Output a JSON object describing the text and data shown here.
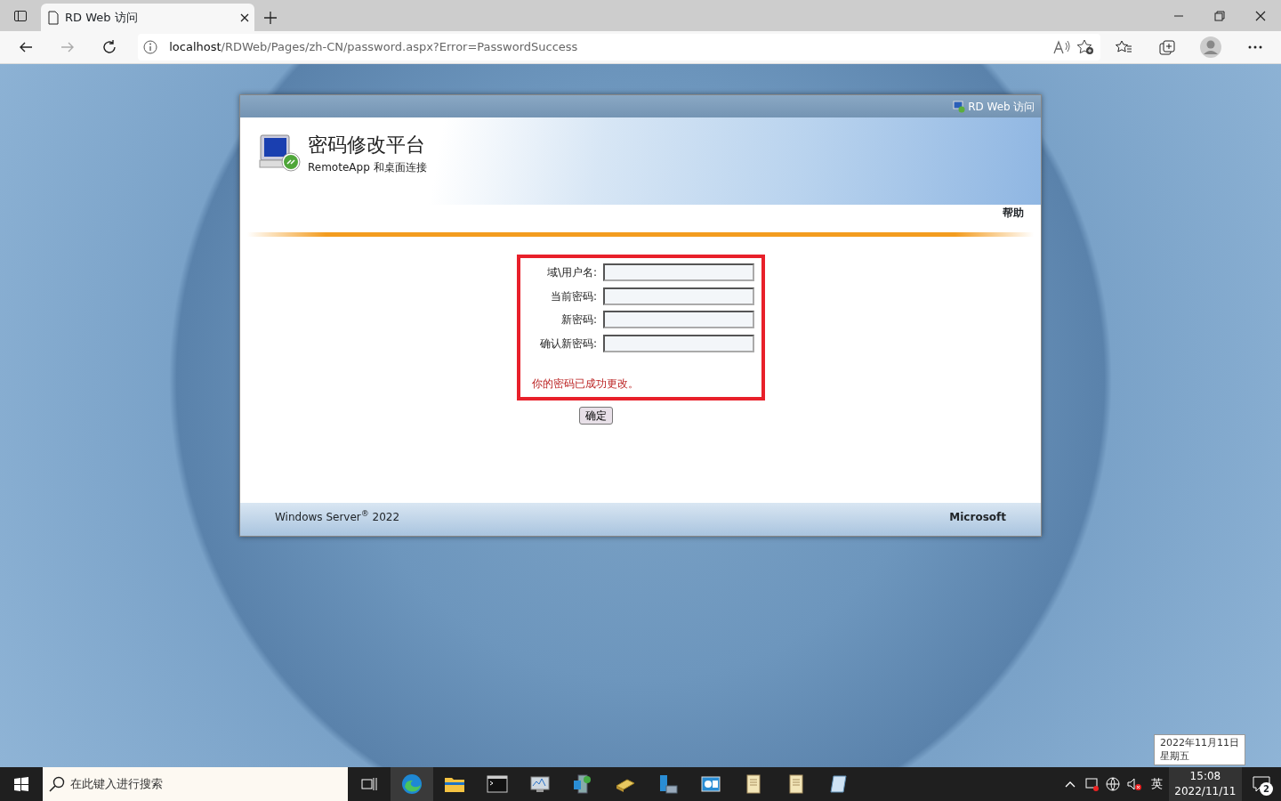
{
  "browser": {
    "tabs": [
      {
        "title": "RD Web 访问",
        "selected": true
      }
    ],
    "address": {
      "host": "localhost",
      "path": "/RDWeb/Pages/zh-CN/password.aspx?Error=PasswordSuccess"
    }
  },
  "page": {
    "top_bar_label": "RD Web 访问",
    "title": "密码修改平台",
    "subtitle": "RemoteApp 和桌面连接",
    "help_link": "帮助",
    "fields": [
      {
        "label": "域\\用户名:"
      },
      {
        "label": "当前密码:"
      },
      {
        "label": "新密码:"
      },
      {
        "label": "确认新密码:"
      }
    ],
    "message": "你的密码已成功更改。",
    "submit_button": "确定",
    "footer_left": "Windows Server$^{®}$ 2022",
    "footer_right": "Microsoft"
  },
  "taskbar": {
    "search_placeholder": "在此键入进行搜索",
    "apps": [
      {
        "kind": "edge",
        "selected": true
      },
      {
        "kind": "folder",
        "selected": false
      },
      {
        "kind": "terminal",
        "selected": false
      },
      {
        "kind": "monitor",
        "selected": false
      },
      {
        "kind": "server",
        "selected": false
      },
      {
        "kind": "tools",
        "selected": false
      },
      {
        "kind": "network",
        "selected": false
      },
      {
        "kind": "dashboard",
        "selected": false
      },
      {
        "kind": "scroll",
        "selected": false
      },
      {
        "kind": "scroll",
        "selected": false
      },
      {
        "kind": "notepad",
        "selected": false
      }
    ],
    "ime": "英",
    "time": "15:08",
    "date": "2022/11/11",
    "notifications": "2",
    "tooltip": [
      "2022年11月11日",
      "星期五"
    ]
  }
}
